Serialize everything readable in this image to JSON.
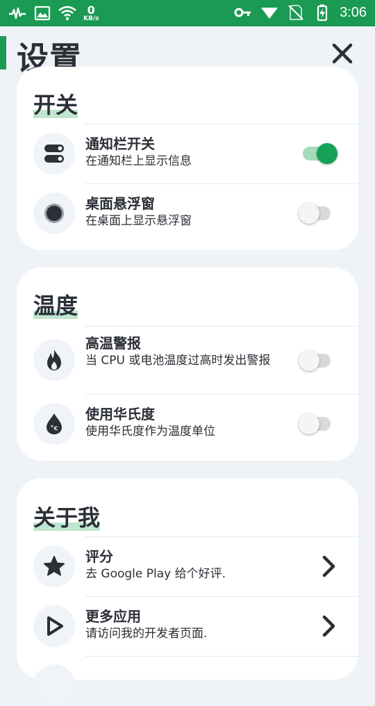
{
  "status_bar": {
    "net_speed_value": "0",
    "net_speed_unit": "KB/s",
    "time": "3:06",
    "icons": [
      "pulse-icon",
      "image-icon",
      "wifi-icon",
      "key-icon",
      "signal-icon",
      "no-sim-icon",
      "battery-charging-icon"
    ]
  },
  "header": {
    "title": "设置",
    "close_icon": "close-icon"
  },
  "sections": [
    {
      "title": "开关",
      "items": [
        {
          "title": "通知栏开关",
          "subtitle": "在通知栏上显示信息",
          "icon": "toggle-icon",
          "control": "switch",
          "on": true
        },
        {
          "title": "桌面悬浮窗",
          "subtitle": "在桌面上显示悬浮窗",
          "icon": "floating-window-icon",
          "control": "switch",
          "on": false
        }
      ]
    },
    {
      "title": "温度",
      "items": [
        {
          "title": "高温警报",
          "subtitle": "当 CPU 或电池温度过高时发出警报",
          "icon": "flame-icon",
          "control": "switch",
          "on": false
        },
        {
          "title": "使用华氏度",
          "subtitle": "使用华氏度作为温度单位",
          "icon": "thermometer-drop-icon",
          "control": "switch",
          "on": false
        }
      ]
    },
    {
      "title": "关于我",
      "items": [
        {
          "title": "评分",
          "subtitle": "去 Google Play 给个好评.",
          "icon": "star-icon",
          "control": "chevron"
        },
        {
          "title": "更多应用",
          "subtitle": "请访问我的开发者页面.",
          "icon": "play-icon",
          "control": "chevron"
        }
      ]
    }
  ],
  "colors": {
    "brand_green": "#1a9a53",
    "highlight_green": "#bfe6d0",
    "background": "#eff3f7",
    "text_dark": "#2b2f36"
  }
}
